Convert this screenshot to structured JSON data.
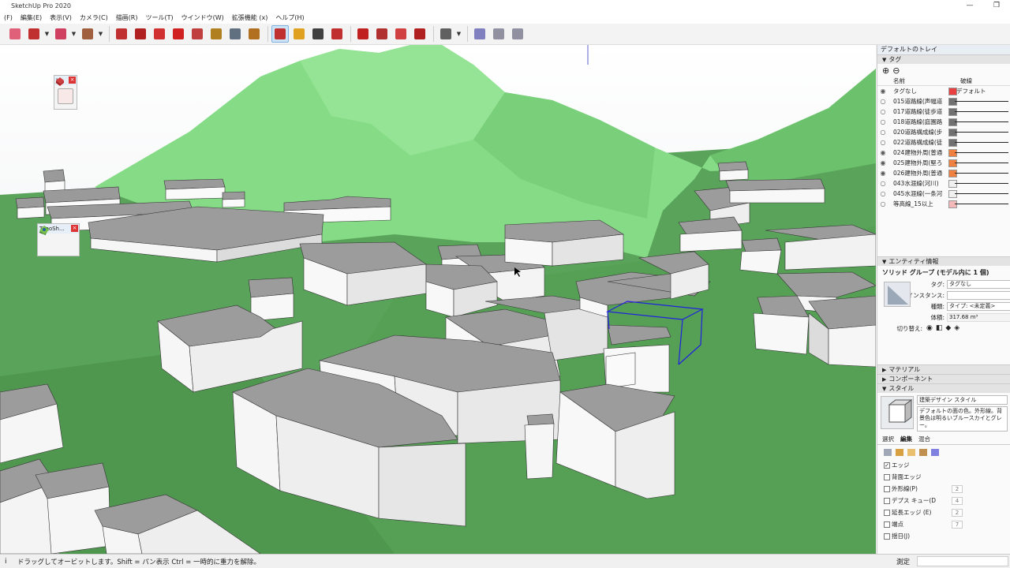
{
  "window": {
    "title": "SketchUp Pro 2020",
    "minimize": "—",
    "restore": "❐"
  },
  "menu": [
    "(F)",
    "編集(E)",
    "表示(V)",
    "カメラ(C)",
    "描画(R)",
    "ツール(T)",
    "ウインドウ(W)",
    "拡張機能 (x)",
    "ヘルプ(H)"
  ],
  "toolbar": {
    "tools": [
      {
        "name": "eraser",
        "color": "#e0607a"
      },
      {
        "name": "pencil",
        "color": "#c03030",
        "arrow": true
      },
      {
        "name": "arc",
        "color": "#d04060",
        "arrow": true
      },
      {
        "name": "rectangle",
        "color": "#a06040",
        "arrow": true
      },
      {
        "name": "push-pull",
        "color": "#c03030"
      },
      {
        "name": "follow-me",
        "color": "#b02020"
      },
      {
        "name": "move",
        "color": "#d03030"
      },
      {
        "name": "rotate",
        "color": "#d02020"
      },
      {
        "name": "scale",
        "color": "#c04040"
      },
      {
        "name": "tape-measure",
        "color": "#b08020"
      },
      {
        "name": "text",
        "color": "#607080"
      },
      {
        "name": "paint-bucket",
        "color": "#b07020"
      },
      {
        "name": "orbit",
        "color": "#c03030",
        "active": true
      },
      {
        "name": "pan",
        "color": "#e0a020"
      },
      {
        "name": "zoom",
        "color": "#404040"
      },
      {
        "name": "zoom-extents",
        "color": "#c03030"
      },
      {
        "name": "warehouse",
        "color": "#c02020"
      },
      {
        "name": "extension-warehouse",
        "color": "#b03030"
      },
      {
        "name": "send-to-layout",
        "color": "#d04040"
      },
      {
        "name": "extension-manager",
        "color": "#b02020"
      },
      {
        "name": "user-account",
        "color": "#606060",
        "arrow": true
      },
      {
        "name": "display-eye",
        "color": "#8080c0"
      },
      {
        "name": "settings-sliders",
        "color": "#9090a0"
      },
      {
        "name": "instructor",
        "color": "#9090a0"
      }
    ]
  },
  "floating": {
    "small_panel_title": "J...",
    "topo_panel_title": "TopoSh..."
  },
  "tray": {
    "title": "デフォルトのトレイ",
    "tags_section": "タグ",
    "add_label": "⊕",
    "remove_label": "⊖",
    "col_name": "名前",
    "col_dash": "破線",
    "tags": [
      {
        "name": "タグなし",
        "visible": true,
        "color": "#e84040",
        "line": "デフォルト"
      },
      {
        "name": "015道路線(声幅道",
        "visible": false,
        "color": "#707070"
      },
      {
        "name": "017道路線(徒歩道",
        "visible": false,
        "color": "#707070"
      },
      {
        "name": "018道路線(庭園路",
        "visible": false,
        "color": "#707070"
      },
      {
        "name": "020道路構成線(步",
        "visible": false,
        "color": "#707070"
      },
      {
        "name": "022道路構成線(徒",
        "visible": false,
        "color": "#707070"
      },
      {
        "name": "024建物外周(普通",
        "visible": true,
        "color": "#f08040"
      },
      {
        "name": "025建物外周(堅ろ",
        "visible": true,
        "color": "#f08040"
      },
      {
        "name": "026建物外周(普通",
        "visible": true,
        "color": "#f08040"
      },
      {
        "name": "043水涯線(河川)",
        "visible": false,
        "color": "#f0f0f0"
      },
      {
        "name": "045水涯線(一条河",
        "visible": false,
        "color": "#f0f0f0"
      },
      {
        "name": "等高線_15以上",
        "visible": false,
        "color": "#f4b8b8"
      }
    ],
    "entity_section": "エンティティ情報",
    "entity_title": "ソリッド グループ (モデル内に 1 個)",
    "entity": {
      "tag_label": "タグ:",
      "tag_value": "タグなし",
      "instance_label": "インスタンス:",
      "instance_value": "",
      "type_label": "種類:",
      "type_value": "タイプ: <未定義>",
      "volume_label": "体積:",
      "volume_value": "317.68 m³",
      "toggle_label": "切り替え:"
    },
    "material_section": "マテリアル",
    "component_section": "コンポーネント",
    "style_section": "スタイル",
    "style_name": "建築デザイン スタイル",
    "style_desc": "デフォルトの面の色。外形線。背景色は明るいブルースカイとグレー。",
    "style_tabs": [
      "選択",
      "編集",
      "混合"
    ],
    "edge_options": [
      {
        "label": "エッジ",
        "checked": true,
        "value": ""
      },
      {
        "label": "背面エッジ",
        "checked": false,
        "value": ""
      },
      {
        "label": "外形線(P)",
        "checked": false,
        "value": "2"
      },
      {
        "label": "デプス キュー(D",
        "checked": false,
        "value": "4"
      },
      {
        "label": "延長エッジ (E)",
        "checked": false,
        "value": "2"
      },
      {
        "label": "端点",
        "checked": false,
        "value": "7"
      },
      {
        "label": "揺日(J)",
        "checked": false,
        "value": ""
      }
    ]
  },
  "status": {
    "message": "ドラッグしてオービットします。Shift = パン表示  Ctrl = 一時的に重力を解除。",
    "measure_label": "測定"
  }
}
